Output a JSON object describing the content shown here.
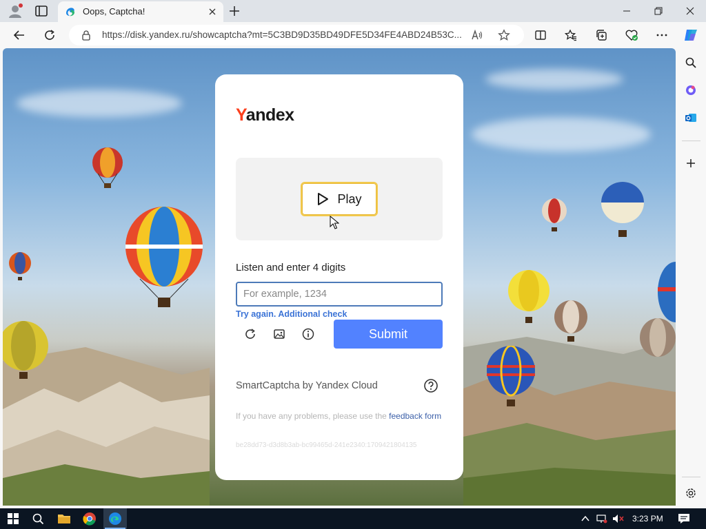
{
  "browser": {
    "tab_title": "Oops, Captcha!",
    "url": "https://disk.yandex.ru/showcaptcha?mt=5C3BD9D35BD49DFE5D34FE4ABD24B53C...",
    "icons": [
      "profile-icon",
      "workspaces-icon",
      "tab-close-icon",
      "new-tab-icon",
      "minimize-icon",
      "restore-icon",
      "window-close-icon",
      "back-icon",
      "refresh-icon",
      "lock-icon",
      "read-aloud-icon",
      "favorite-star-icon",
      "split-screen-icon",
      "favorites-icon",
      "collections-icon",
      "browser-essentials-icon",
      "more-icon",
      "copilot-icon"
    ]
  },
  "sidebar": {
    "icons": [
      "search-icon",
      "copilot-sidebar-icon",
      "outlook-icon",
      "add-icon",
      "settings-icon"
    ]
  },
  "captcha": {
    "logo": "Yandex",
    "play_label": "Play",
    "instruction": "Listen and enter 4 digits",
    "input_placeholder": "For example, 1234",
    "input_value": "",
    "try_again": "Try again.",
    "additional_check": "Additional check",
    "submit_label": "Submit",
    "brand": "SmartCaptcha by Yandex Cloud",
    "problems_text": "If you have any problems, please use the ",
    "feedback_link": "feedback form",
    "hash": "be28dd73-d3d8b3ab-bc99465d-241e2340:1709421804135"
  },
  "taskbar": {
    "time": "3:23 PM",
    "icons": [
      "windows-start-icon",
      "taskbar-search-icon",
      "file-explorer-icon",
      "chrome-icon",
      "edge-icon",
      "show-hidden-icons-icon",
      "network-icon",
      "volume-muted-icon",
      "notifications-icon"
    ]
  },
  "colors": {
    "accent": "#5282ff",
    "yandex_red": "#fc3f1d",
    "link": "#3b73d6",
    "play_border": "#f2c94c"
  }
}
